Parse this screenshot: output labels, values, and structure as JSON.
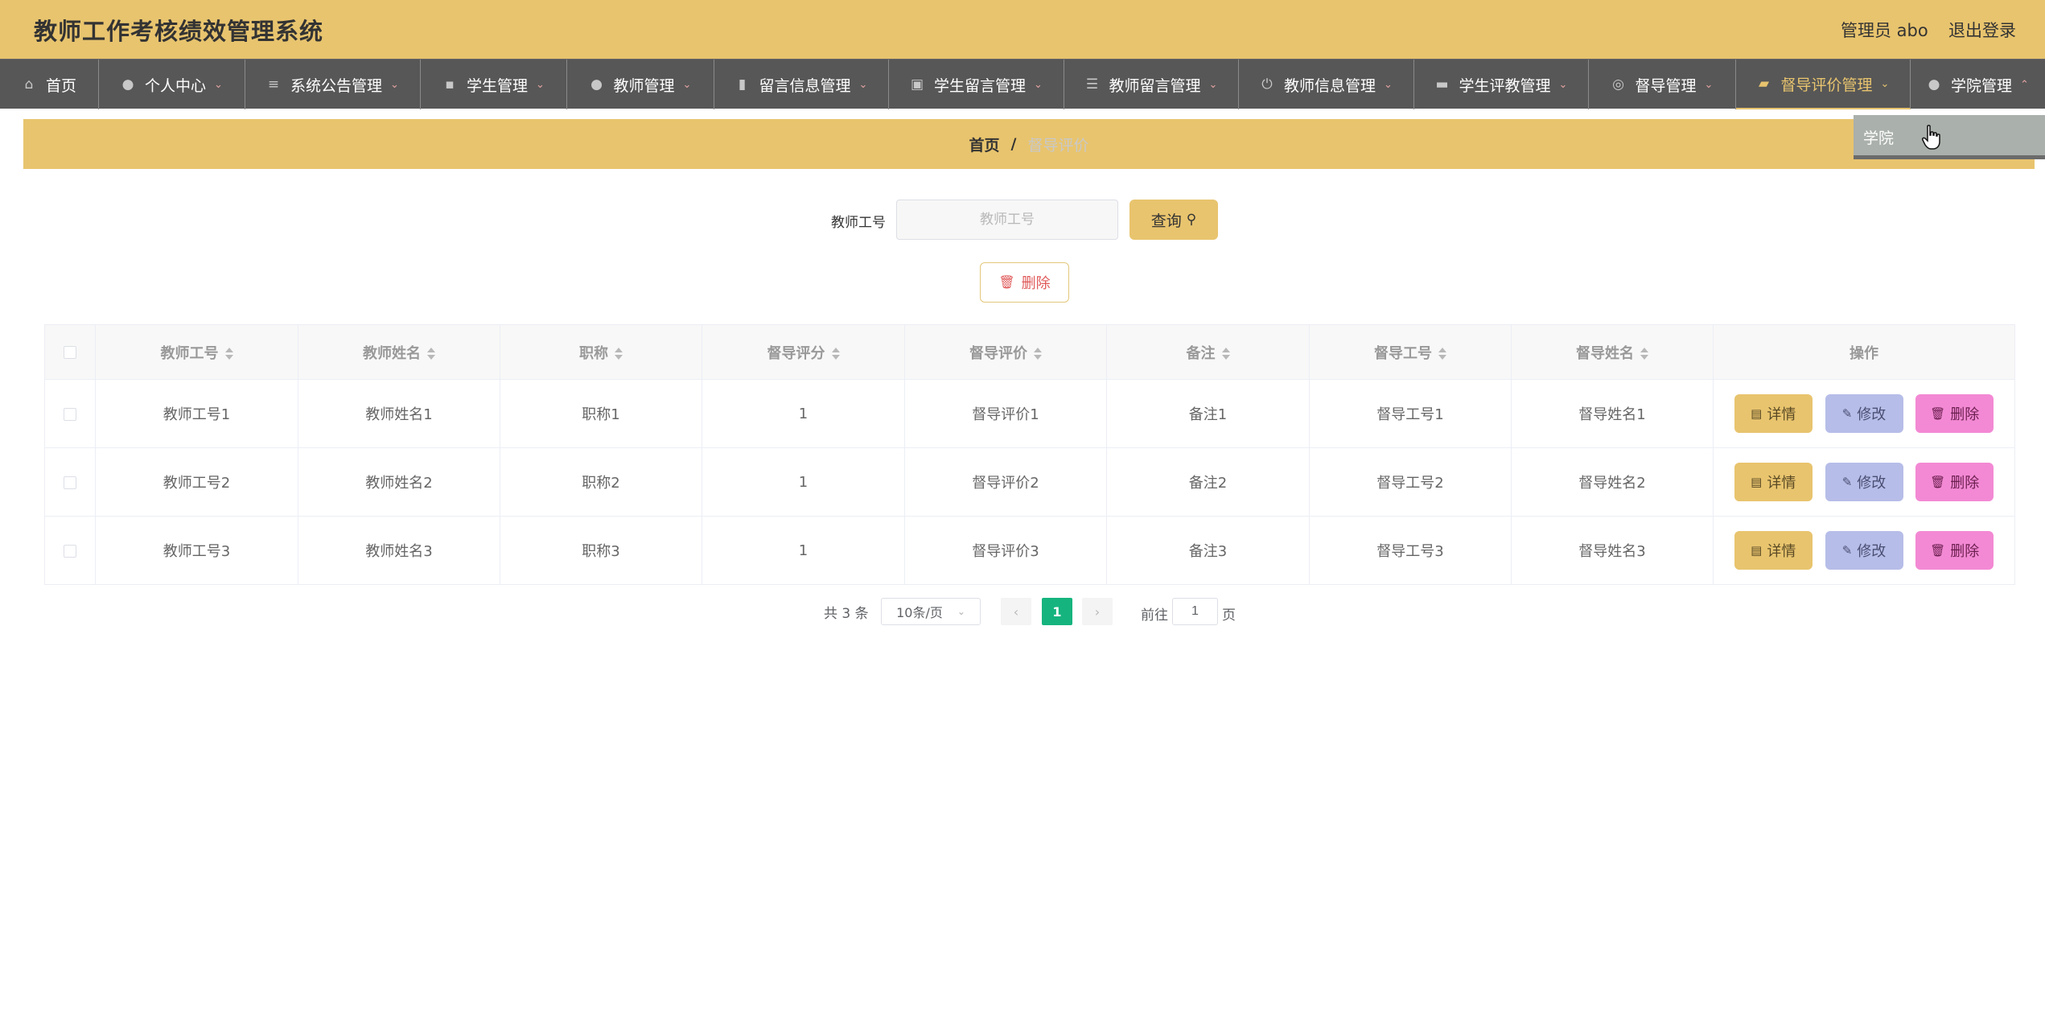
{
  "header": {
    "title": "教师工作考核绩效管理系统",
    "admin": "管理员 abo",
    "logout": "退出登录"
  },
  "nav": {
    "items": [
      {
        "label": "首页",
        "icon": "home-icon"
      },
      {
        "label": "个人中心",
        "icon": "user-icon"
      },
      {
        "label": "系统公告管理",
        "icon": "sliders-icon"
      },
      {
        "label": "学生管理",
        "icon": "chat-icon"
      },
      {
        "label": "教师管理",
        "icon": "location-icon"
      },
      {
        "label": "留言信息管理",
        "icon": "bar-chart-icon"
      },
      {
        "label": "学生留言管理",
        "icon": "clipboard-icon"
      },
      {
        "label": "教师留言管理",
        "icon": "list-icon"
      },
      {
        "label": "教师信息管理",
        "icon": "power-icon"
      },
      {
        "label": "学生评教管理",
        "icon": "monitor-icon"
      },
      {
        "label": "督导管理",
        "icon": "circle-icon"
      },
      {
        "label": "督导评价管理",
        "icon": "briefcase-icon"
      },
      {
        "label": "学院管理",
        "icon": "person-icon"
      }
    ],
    "dropdown_item": "学院"
  },
  "breadcrumb": {
    "home": "首页",
    "separator": "/",
    "current": "督导评价"
  },
  "search": {
    "label": "教师工号",
    "placeholder": "教师工号",
    "button": "查询"
  },
  "toolbar": {
    "delete": "删除"
  },
  "table": {
    "headers": [
      "教师工号",
      "教师姓名",
      "职称",
      "督导评分",
      "督导评价",
      "备注",
      "督导工号",
      "督导姓名",
      "操作"
    ],
    "rows": [
      [
        "教师工号1",
        "教师姓名1",
        "职称1",
        "1",
        "督导评价1",
        "备注1",
        "督导工号1",
        "督导姓名1"
      ],
      [
        "教师工号2",
        "教师姓名2",
        "职称2",
        "1",
        "督导评价2",
        "备注2",
        "督导工号2",
        "督导姓名2"
      ],
      [
        "教师工号3",
        "教师姓名3",
        "职称3",
        "1",
        "督导评价3",
        "备注3",
        "督导工号3",
        "督导姓名3"
      ]
    ],
    "actions": {
      "detail": "详情",
      "edit": "修改",
      "delete": "删除"
    }
  },
  "pagination": {
    "total": "共 3 条",
    "page_size": "10条/页",
    "current_page": "1",
    "goto": "前往",
    "goto_value": "1",
    "page_suffix": "页"
  },
  "colors": {
    "accent": "#e8c46e",
    "nav_bg": "#575757",
    "active_page": "#15b47e",
    "edit_button": "#b6bde8",
    "delete_button": "#f389d4"
  }
}
